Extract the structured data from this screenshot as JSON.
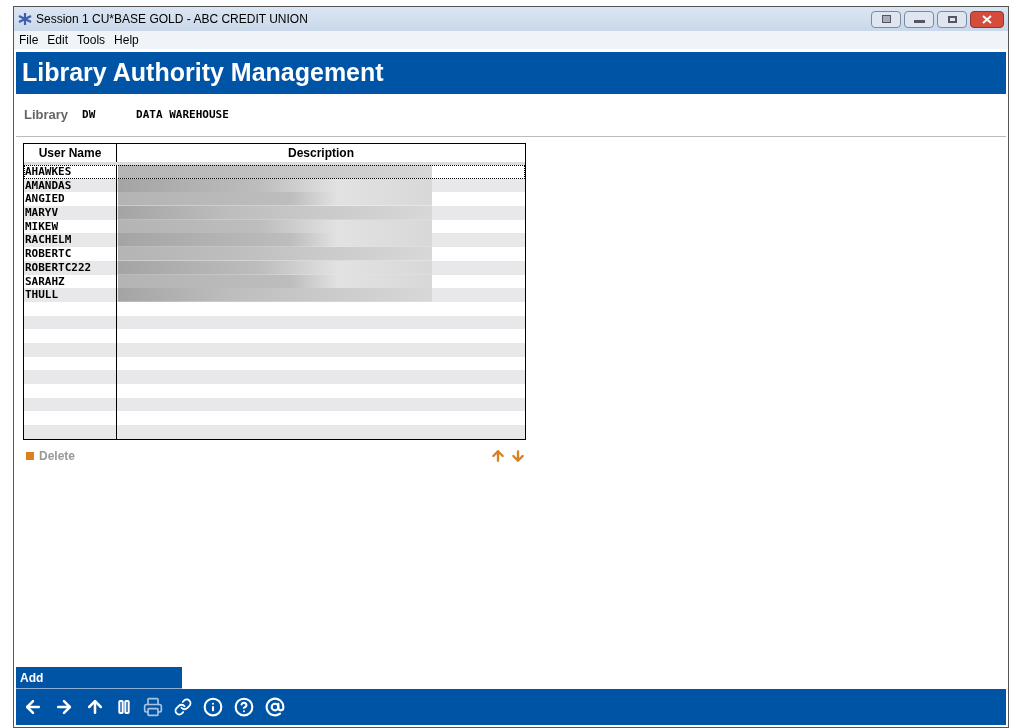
{
  "window": {
    "title": "Session 1 CU*BASE GOLD - ABC CREDIT UNION"
  },
  "menu": [
    "File",
    "Edit",
    "Tools",
    "Help"
  ],
  "header": {
    "title": "Library Authority Management"
  },
  "library": {
    "label": "Library",
    "code": "DW",
    "name": "DATA WAREHOUSE"
  },
  "table": {
    "columns": [
      "User Name",
      "Description"
    ],
    "rows": [
      {
        "user": "AHAWKES",
        "selected": true
      },
      {
        "user": "AMANDAS",
        "selected": false
      },
      {
        "user": "ANGIED",
        "selected": false
      },
      {
        "user": "MARYV",
        "selected": false
      },
      {
        "user": "MIKEW",
        "selected": false
      },
      {
        "user": "RACHELM",
        "selected": false
      },
      {
        "user": "ROBERTC",
        "selected": false
      },
      {
        "user": "ROBERTC222",
        "selected": false
      },
      {
        "user": "SARAHZ",
        "selected": false
      },
      {
        "user": "THULL",
        "selected": false
      }
    ]
  },
  "actions": [
    {
      "label": "Delete",
      "disabled": true
    }
  ],
  "function_bar": {
    "label": "Add"
  }
}
